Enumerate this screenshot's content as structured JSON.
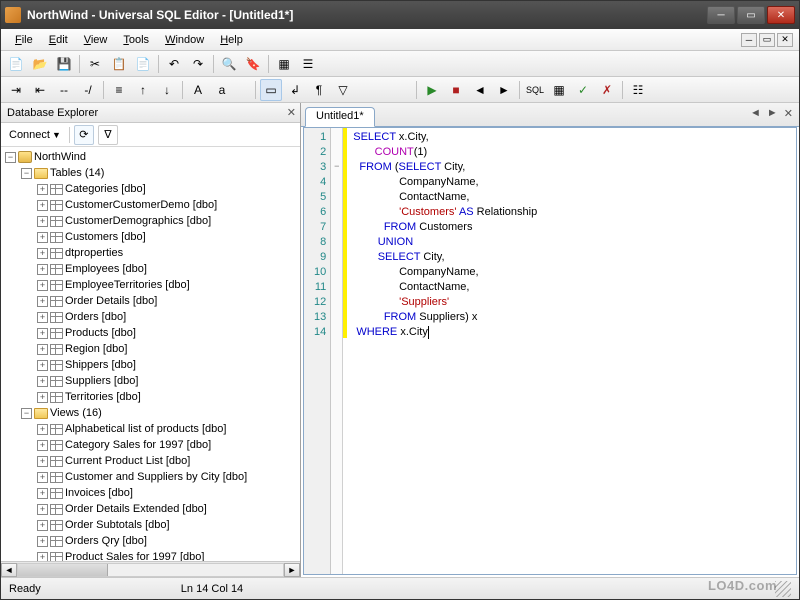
{
  "title": "NorthWind - Universal SQL Editor - [Untitled1*]",
  "menus": [
    "File",
    "Edit",
    "View",
    "Tools",
    "Window",
    "Help"
  ],
  "explorer": {
    "title": "Database Explorer",
    "connect_label": "Connect",
    "root": "NorthWind",
    "tables_label": "Tables (14)",
    "tables": [
      "Categories [dbo]",
      "CustomerCustomerDemo [dbo]",
      "CustomerDemographics [dbo]",
      "Customers [dbo]",
      "dtproperties",
      "Employees [dbo]",
      "EmployeeTerritories [dbo]",
      "Order Details [dbo]",
      "Orders [dbo]",
      "Products [dbo]",
      "Region [dbo]",
      "Shippers [dbo]",
      "Suppliers [dbo]",
      "Territories [dbo]"
    ],
    "views_label": "Views (16)",
    "views": [
      "Alphabetical list of products [dbo]",
      "Category Sales for 1997 [dbo]",
      "Current Product List [dbo]",
      "Customer and Suppliers by City [dbo]",
      "Invoices [dbo]",
      "Order Details Extended [dbo]",
      "Order Subtotals [dbo]",
      "Orders Qry [dbo]",
      "Product Sales for 1997 [dbo]"
    ]
  },
  "tab": "Untitled1*",
  "code": {
    "lines": [
      {
        "n": 1,
        "pre": "",
        "tokens": [
          {
            "t": "SELECT",
            "c": "kw"
          },
          {
            "t": " x.City,"
          }
        ]
      },
      {
        "n": 2,
        "pre": "       ",
        "tokens": [
          {
            "t": "COUNT",
            "c": "fn"
          },
          {
            "t": "(1)"
          }
        ]
      },
      {
        "n": 3,
        "pre": "  ",
        "tokens": [
          {
            "t": "FROM",
            "c": "kw"
          },
          {
            "t": " ("
          },
          {
            "t": "SELECT",
            "c": "kw"
          },
          {
            "t": " City,"
          }
        ]
      },
      {
        "n": 4,
        "pre": "               ",
        "tokens": [
          {
            "t": "CompanyName,"
          }
        ]
      },
      {
        "n": 5,
        "pre": "               ",
        "tokens": [
          {
            "t": "ContactName,"
          }
        ]
      },
      {
        "n": 6,
        "pre": "               ",
        "tokens": [
          {
            "t": "'Customers'",
            "c": "str"
          },
          {
            "t": " "
          },
          {
            "t": "AS",
            "c": "kw"
          },
          {
            "t": " Relationship"
          }
        ]
      },
      {
        "n": 7,
        "pre": "          ",
        "tokens": [
          {
            "t": "FROM",
            "c": "kw"
          },
          {
            "t": " Customers"
          }
        ]
      },
      {
        "n": 8,
        "pre": "        ",
        "tokens": [
          {
            "t": "UNION",
            "c": "kw"
          }
        ]
      },
      {
        "n": 9,
        "pre": "        ",
        "tokens": [
          {
            "t": "SELECT",
            "c": "kw"
          },
          {
            "t": " City,"
          }
        ]
      },
      {
        "n": 10,
        "pre": "               ",
        "tokens": [
          {
            "t": "CompanyName,"
          }
        ]
      },
      {
        "n": 11,
        "pre": "               ",
        "tokens": [
          {
            "t": "ContactName,"
          }
        ]
      },
      {
        "n": 12,
        "pre": "               ",
        "tokens": [
          {
            "t": "'Suppliers'",
            "c": "str"
          }
        ]
      },
      {
        "n": 13,
        "pre": "          ",
        "tokens": [
          {
            "t": "FROM",
            "c": "kw"
          },
          {
            "t": " Suppliers) x"
          }
        ]
      },
      {
        "n": 14,
        "pre": " ",
        "tokens": [
          {
            "t": "WHERE",
            "c": "kw"
          },
          {
            "t": " x.City"
          }
        ],
        "cursor": true
      }
    ]
  },
  "status": {
    "ready": "Ready",
    "pos": "Ln 14   Col 14"
  },
  "watermark": "LO4D.com"
}
